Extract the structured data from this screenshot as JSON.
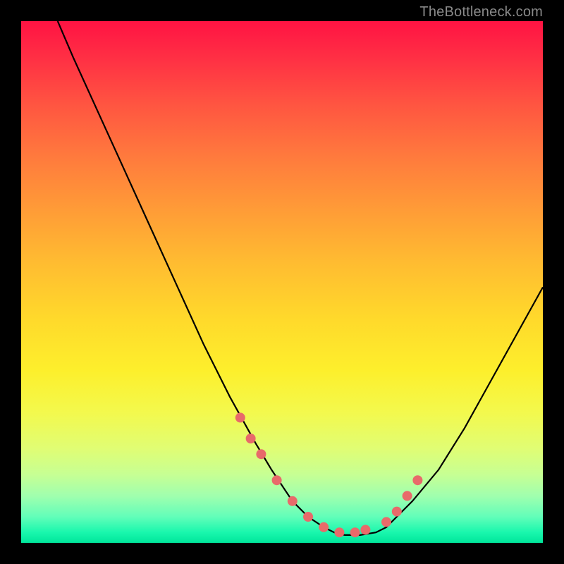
{
  "watermark": "TheBottleneck.com",
  "chart_data": {
    "type": "line",
    "title": "",
    "xlabel": "",
    "ylabel": "",
    "xlim": [
      0,
      100
    ],
    "ylim": [
      0,
      100
    ],
    "series": [
      {
        "name": "curve",
        "x": [
          7,
          10,
          15,
          20,
          25,
          30,
          35,
          40,
          45,
          48,
          50,
          52,
          55,
          58,
          60,
          62,
          65,
          68,
          70,
          72,
          75,
          80,
          85,
          90,
          95,
          100
        ],
        "y": [
          100,
          93,
          82,
          71,
          60,
          49,
          38,
          28,
          19,
          14,
          11,
          8,
          5,
          3,
          2,
          1.5,
          1.5,
          2,
          3,
          5,
          8,
          14,
          22,
          31,
          40,
          49
        ]
      }
    ],
    "markers": {
      "name": "dots",
      "color": "#e86a6a",
      "radius_px": 7,
      "x": [
        42,
        44,
        46,
        49,
        52,
        55,
        58,
        61,
        64,
        66,
        70,
        72,
        74,
        76
      ],
      "y": [
        24,
        20,
        17,
        12,
        8,
        5,
        3,
        2,
        2,
        2.5,
        4,
        6,
        9,
        12
      ]
    }
  },
  "colors": {
    "curve_stroke": "#000000",
    "marker_fill": "#e86a6a",
    "background_black": "#000000"
  }
}
